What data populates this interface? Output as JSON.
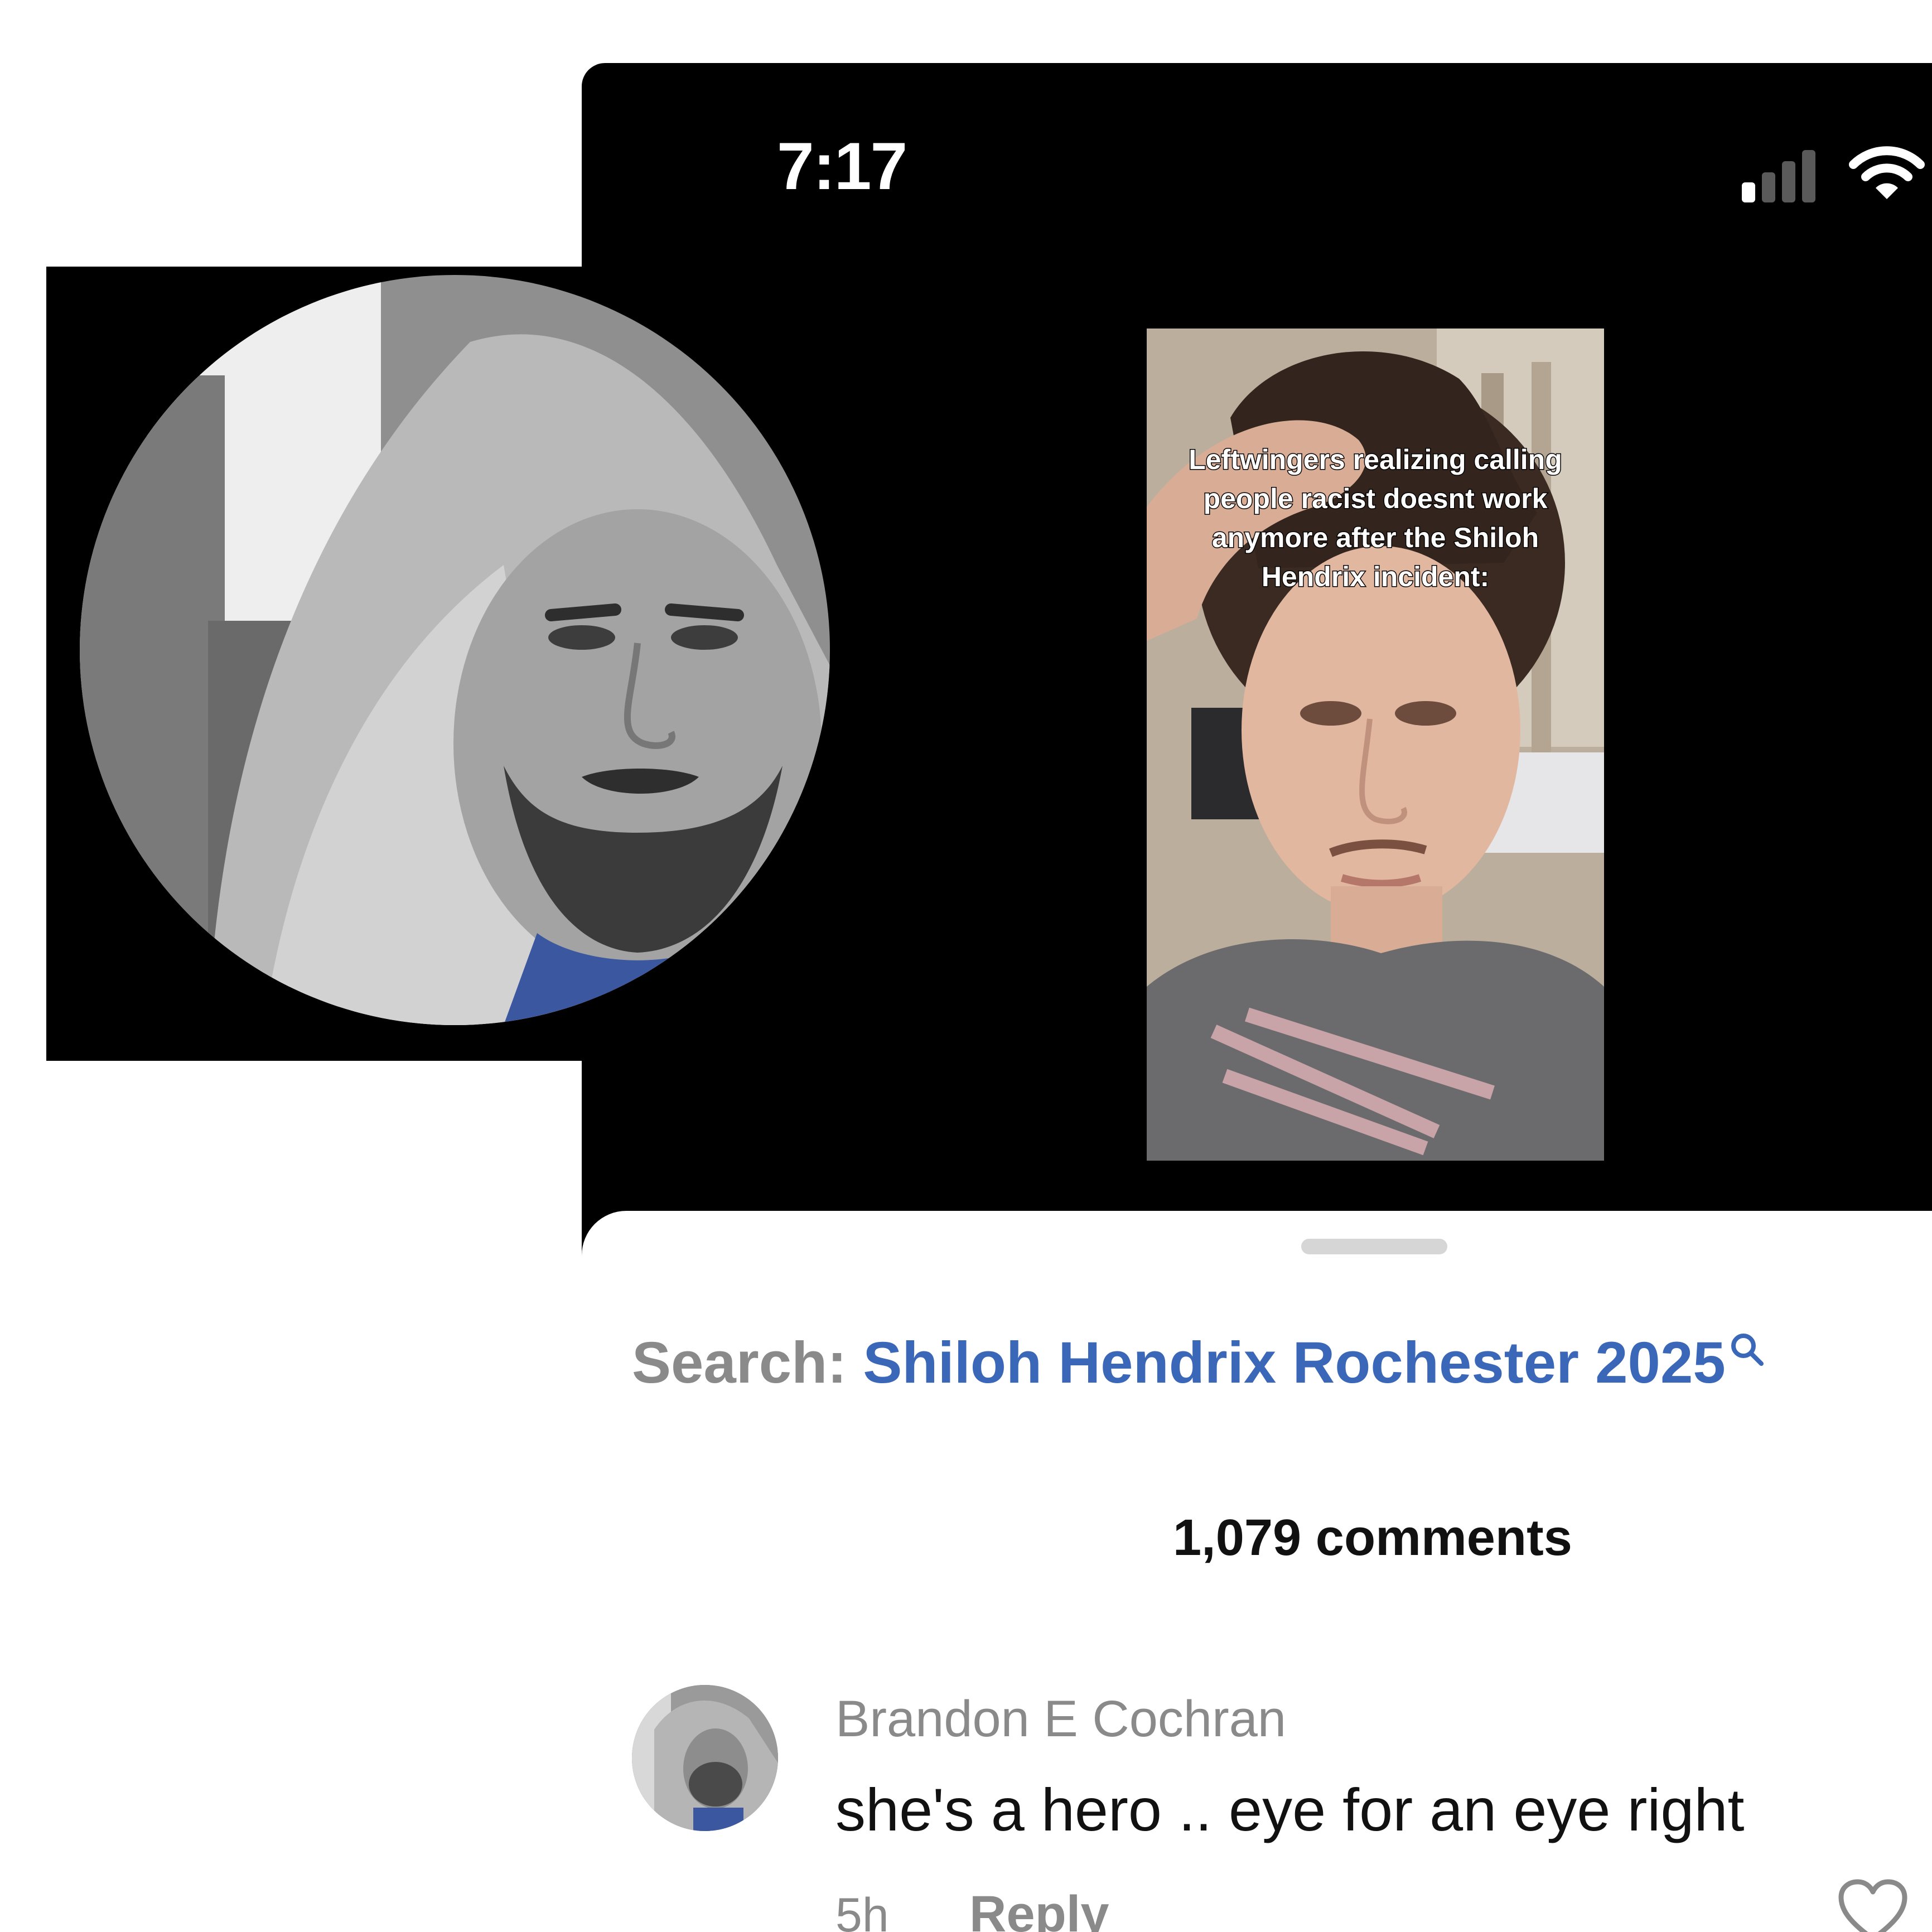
{
  "status_bar": {
    "time": "7:17",
    "signal_icon": "cellular-signal-icon",
    "wifi_icon": "wifi-icon"
  },
  "video": {
    "caption": "Leftwingers realizing calling people racist doesnt work anymore after the Shiloh Hendrix incident:"
  },
  "sheet": {
    "search_label": "Search:",
    "search_term": "Shiloh Hendrix Rochester 2025",
    "search_icon": "search-icon",
    "comments_count": "1,079 comments"
  },
  "comment": {
    "author": "Brandon E Cochran",
    "text": "she's a hero .. eye for an eye right",
    "time": "5h",
    "reply_label": "Reply",
    "like_icon": "heart-icon"
  },
  "colors": {
    "search_link": "#3a67b8",
    "muted_text": "#8a8a8a",
    "primary_text": "#111111",
    "dark_background": "#000000"
  }
}
